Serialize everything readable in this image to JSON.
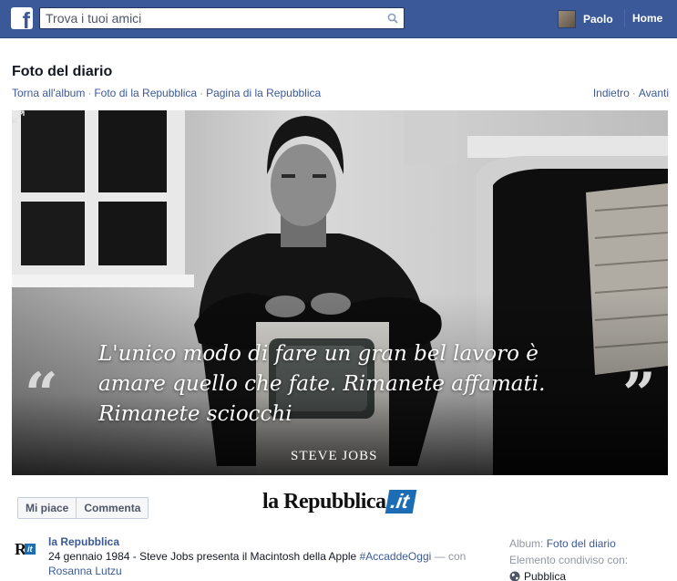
{
  "topbar": {
    "search_placeholder": "Trova i tuoi amici",
    "user_name": "Paolo",
    "home_label": "Home",
    "brand_color": "#3b5998"
  },
  "header": {
    "title": "Foto del diario",
    "breadcrumbs": [
      "Torna all'album",
      "Foto di la Repubblica",
      "Pagina di la Repubblica"
    ],
    "prev_label": "Indietro",
    "next_label": "Avanti"
  },
  "photo": {
    "quote": "L'unico modo di fare un gran bel lavoro è amare quello che fate. Rimanete affamati. Rimanete sciocchi",
    "quote_open": "“",
    "quote_close": "”",
    "author": "STEVE JOBS"
  },
  "actions": {
    "like_label": "Mi piace",
    "comment_label": "Commenta"
  },
  "brand": {
    "name": "la Repubblica",
    "suffix": ".it",
    "logo_r": "R",
    "logo_it": "it"
  },
  "post": {
    "author": "la Repubblica",
    "text": "24 gennaio 1984 - Steve Jobs presenta il Macintosh della Apple ",
    "hashtag": "#AccaddeOggi",
    "with_label": " — con",
    "tagged_person": "Rosanna Lutzu"
  },
  "sidebar": {
    "album_label": "Album:",
    "album_name": "Foto del diario",
    "shared_label": "Elemento condiviso con:",
    "audience": "Pubblica"
  }
}
